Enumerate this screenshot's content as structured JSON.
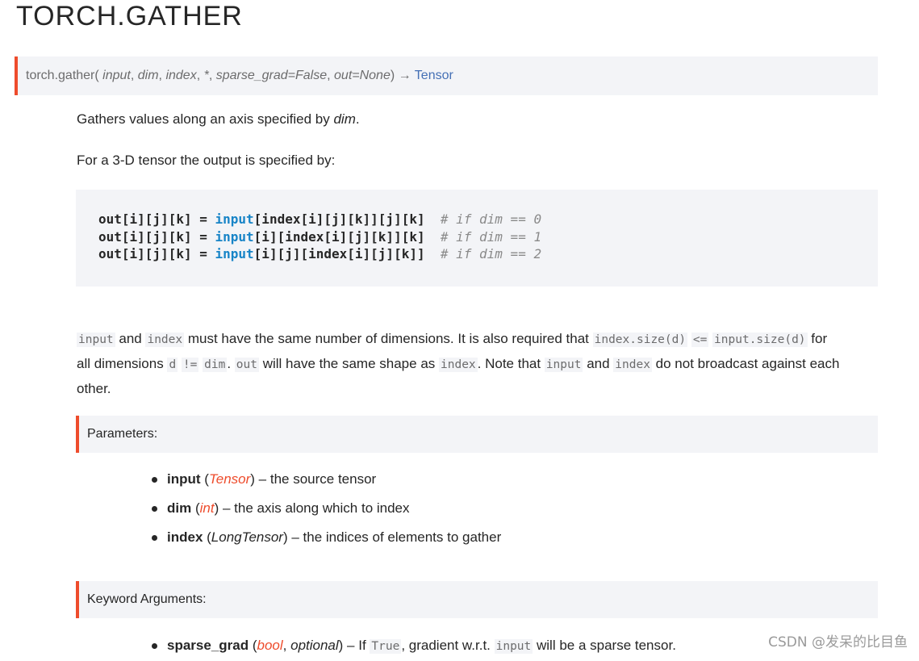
{
  "title": "TORCH.GATHER",
  "signature": {
    "name": "torch.gather",
    "open": "(",
    "p_input": "input",
    "p_dim": "dim",
    "p_index": "index",
    "p_star": "*",
    "p_sparse": "sparse_grad=False",
    "p_out": "out=None",
    "close": ")",
    "arrow": "→",
    "return_type": "Tensor"
  },
  "intro": {
    "text": "Gathers values along an axis specified by ",
    "dim": "dim",
    "end": "."
  },
  "formula_intro": "For a 3-D tensor the output is specified by:",
  "code_lines": [
    {
      "lhs": "out[i][j][k] = ",
      "kw": "input",
      "rhs": "[index[i][j][k]][j][k]  ",
      "comment": "# if dim == 0"
    },
    {
      "lhs": "out[i][j][k] = ",
      "kw": "input",
      "rhs": "[i][index[i][j][k]][k]  ",
      "comment": "# if dim == 1"
    },
    {
      "lhs": "out[i][j][k] = ",
      "kw": "input",
      "rhs": "[i][j][index[i][j][k]]  ",
      "comment": "# if dim == 2"
    }
  ],
  "desc": {
    "c1": "input",
    "t1": " and ",
    "c2": "index",
    "t2": " must have the same number of dimensions. It is also required that ",
    "c3": "index.size(d)",
    "t3": " ",
    "c4": "<=",
    "t4": " ",
    "c5": "input.size(d)",
    "t5": " for",
    "t6": "all dimensions ",
    "c6": "d",
    "t7": " ",
    "c7": "!=",
    "t8": " ",
    "c8": "dim",
    "t9": ". ",
    "c9": "out",
    "t10": " will have the same shape as ",
    "c10": "index",
    "t11": ". Note that ",
    "c11": "input",
    "t12": " and ",
    "c12": "index",
    "t13": " do not broadcast against each",
    "t14": "other."
  },
  "parameters": {
    "heading": "Parameters:",
    "items": [
      {
        "name": "input",
        "open": " (",
        "type": "Tensor",
        "close": ") – ",
        "desc": "the source tensor"
      },
      {
        "name": "dim",
        "open": " (",
        "type": "int",
        "close": ") – ",
        "desc": "the axis along which to index"
      },
      {
        "name": "index",
        "open": " (",
        "type": "LongTensor",
        "close": ") – ",
        "desc": "the indices of elements to gather"
      }
    ]
  },
  "keyword_args": {
    "heading": "Keyword Arguments:",
    "item": {
      "name": "sparse_grad",
      "open": " (",
      "type": "bool",
      "sep": ", ",
      "optional": "optional",
      "close": ") – If ",
      "c1": "True",
      "t1": ", gradient w.r.t. ",
      "c2": "input",
      "t2": " will be a sparse tensor."
    }
  },
  "watermark": "CSDN @发呆的比目鱼",
  "colors": {
    "accent": "#ee4c2c",
    "link": "#4570b5",
    "keyword": "#1784c7",
    "code_bg": "#f3f4f7"
  }
}
